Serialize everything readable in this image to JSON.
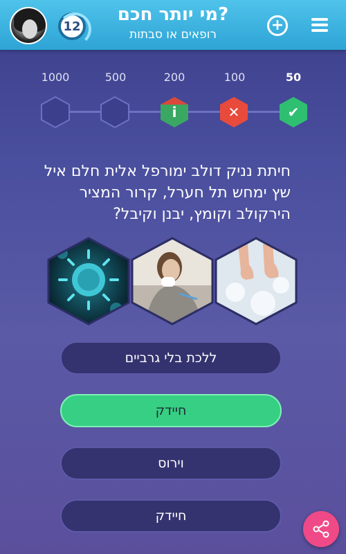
{
  "header": {
    "title": "מי יותר חכם?",
    "subtitle": "רופאים או סבתות",
    "level": "12",
    "plus_icon": "plus-circle-icon",
    "menu_icon": "hamburger-menu-icon"
  },
  "ladder": {
    "labels": [
      "1000",
      "500",
      "200",
      "100",
      "50"
    ],
    "current_label": "50",
    "steps": [
      {
        "state": "empty",
        "icon": ""
      },
      {
        "state": "empty",
        "icon": ""
      },
      {
        "state": "info",
        "icon": "i"
      },
      {
        "state": "wrong",
        "icon": "✕"
      },
      {
        "state": "done",
        "icon": "✔"
      }
    ],
    "colors": {
      "info": "#3aa763",
      "info_top": "#d9483b",
      "wrong": "#e84a3c",
      "done": "#2fbf71"
    }
  },
  "question": {
    "text": "חיתת נניק דולב ימורפל אלית חלם איל שץ ימחש תל חערל, קרור המציר הירקולב וקומץ, יבנן וקיבל?"
  },
  "images": [
    {
      "name": "virus-image",
      "subject": "virus"
    },
    {
      "name": "sick-woman-image",
      "subject": "sick woman with thermometer"
    },
    {
      "name": "bare-feet-snow-image",
      "subject": "bare feet on snow"
    }
  ],
  "answers": [
    {
      "label": "ללכת בלי גרביים",
      "state": "normal"
    },
    {
      "label": "חיידק",
      "state": "correct"
    },
    {
      "label": "וירוס",
      "state": "normal"
    },
    {
      "label": "חיידק",
      "state": "normal"
    }
  ],
  "share": {
    "icon": "share-icon",
    "color": "#ef4a87"
  }
}
